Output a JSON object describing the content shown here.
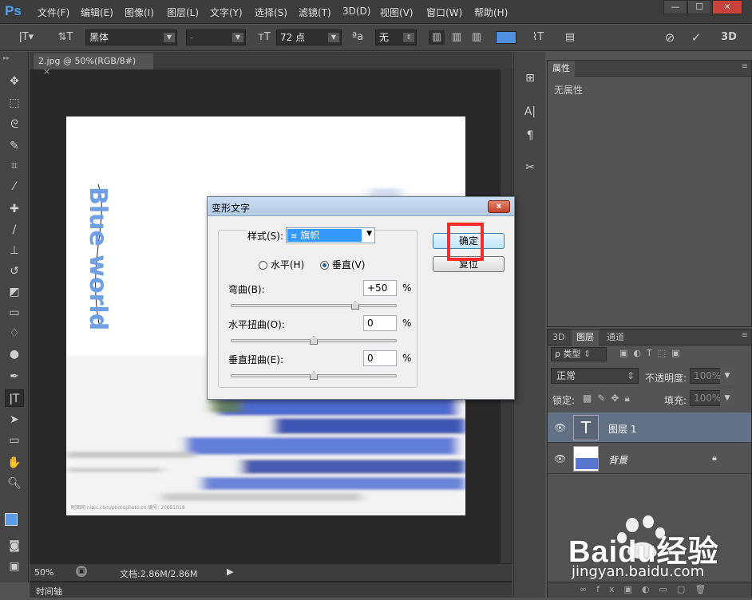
{
  "app": {
    "logo": "Ps",
    "menu": [
      "文件(F)",
      "编辑(E)",
      "图像(I)",
      "图层(L)",
      "文字(Y)",
      "选择(S)",
      "滤镜(T)",
      "3D(D)",
      "视图(V)",
      "窗口(W)",
      "帮助(H)"
    ]
  },
  "options_bar": {
    "font_family": "黑体",
    "font_style": "-",
    "font_size": "72 点",
    "aa_label": "ªa",
    "antialias": "无",
    "threed_label": "3D"
  },
  "document": {
    "tab_title": "2.jpg @ 50%(RGB/8#)",
    "warped_text": "Blue world",
    "credit": "昵图网 nipic.com/photophoto.cn   编号: 20051018",
    "zoom": "50%",
    "doc_size": "文档:2.86M/2.86M",
    "timeline_label": "时间轴"
  },
  "properties_panel": {
    "tab": "属性",
    "empty_text": "无属性"
  },
  "layers_panel": {
    "tabs": [
      "3D",
      "图层",
      "通道"
    ],
    "filter_kind": "ρ 类型",
    "blend_mode": "正常",
    "opacity_label": "不透明度:",
    "opacity_value": "100%",
    "lock_label": "锁定:",
    "fill_label": "填充:",
    "fill_value": "100%",
    "layers": [
      {
        "name": "图层 1",
        "kind": "text",
        "thumb": "T"
      },
      {
        "name": "背景",
        "kind": "image"
      }
    ]
  },
  "dialog": {
    "title": "变形文字",
    "close": "x",
    "style_label": "样式(S):",
    "style_value": "旗帜",
    "horizontal_label": "水平(H)",
    "vertical_label": "垂直(V)",
    "orientation": "vertical",
    "bend_label": "弯曲(B):",
    "bend_value": "+50",
    "bend_fraction": 0.75,
    "hdistort_label": "水平扭曲(O):",
    "hdistort_value": "0",
    "hdistort_fraction": 0.5,
    "vdistort_label": "垂直扭曲(E):",
    "vdistort_value": "0",
    "vdistort_fraction": 0.5,
    "percent": "%",
    "ok_label": "确定",
    "reset_label": "复位"
  },
  "watermark": {
    "text": "Baidu经验",
    "url": "jingyan.baidu.com"
  },
  "colors": {
    "accent": "#4fa3f7",
    "highlight_box": "#ff2b2b",
    "selection": "#3399ff"
  }
}
